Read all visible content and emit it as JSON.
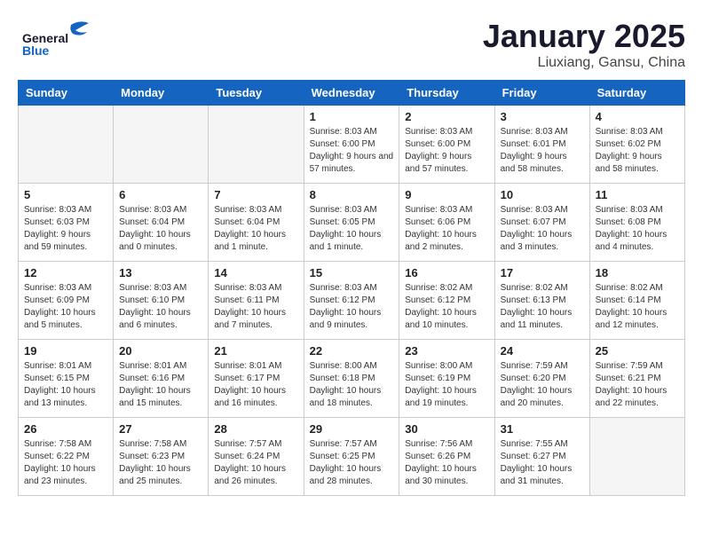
{
  "header": {
    "logo_general": "General",
    "logo_blue": "Blue",
    "month_title": "January 2025",
    "location": "Liuxiang, Gansu, China"
  },
  "columns": [
    "Sunday",
    "Monday",
    "Tuesday",
    "Wednesday",
    "Thursday",
    "Friday",
    "Saturday"
  ],
  "weeks": [
    [
      {
        "day": "",
        "info": ""
      },
      {
        "day": "",
        "info": ""
      },
      {
        "day": "",
        "info": ""
      },
      {
        "day": "1",
        "info": "Sunrise: 8:03 AM\nSunset: 6:00 PM\nDaylight: 9 hours\nand 57 minutes."
      },
      {
        "day": "2",
        "info": "Sunrise: 8:03 AM\nSunset: 6:00 PM\nDaylight: 9 hours\nand 57 minutes."
      },
      {
        "day": "3",
        "info": "Sunrise: 8:03 AM\nSunset: 6:01 PM\nDaylight: 9 hours\nand 58 minutes."
      },
      {
        "day": "4",
        "info": "Sunrise: 8:03 AM\nSunset: 6:02 PM\nDaylight: 9 hours\nand 58 minutes."
      }
    ],
    [
      {
        "day": "5",
        "info": "Sunrise: 8:03 AM\nSunset: 6:03 PM\nDaylight: 9 hours\nand 59 minutes."
      },
      {
        "day": "6",
        "info": "Sunrise: 8:03 AM\nSunset: 6:04 PM\nDaylight: 10 hours\nand 0 minutes."
      },
      {
        "day": "7",
        "info": "Sunrise: 8:03 AM\nSunset: 6:04 PM\nDaylight: 10 hours\nand 1 minute."
      },
      {
        "day": "8",
        "info": "Sunrise: 8:03 AM\nSunset: 6:05 PM\nDaylight: 10 hours\nand 1 minute."
      },
      {
        "day": "9",
        "info": "Sunrise: 8:03 AM\nSunset: 6:06 PM\nDaylight: 10 hours\nand 2 minutes."
      },
      {
        "day": "10",
        "info": "Sunrise: 8:03 AM\nSunset: 6:07 PM\nDaylight: 10 hours\nand 3 minutes."
      },
      {
        "day": "11",
        "info": "Sunrise: 8:03 AM\nSunset: 6:08 PM\nDaylight: 10 hours\nand 4 minutes."
      }
    ],
    [
      {
        "day": "12",
        "info": "Sunrise: 8:03 AM\nSunset: 6:09 PM\nDaylight: 10 hours\nand 5 minutes."
      },
      {
        "day": "13",
        "info": "Sunrise: 8:03 AM\nSunset: 6:10 PM\nDaylight: 10 hours\nand 6 minutes."
      },
      {
        "day": "14",
        "info": "Sunrise: 8:03 AM\nSunset: 6:11 PM\nDaylight: 10 hours\nand 7 minutes."
      },
      {
        "day": "15",
        "info": "Sunrise: 8:03 AM\nSunset: 6:12 PM\nDaylight: 10 hours\nand 9 minutes."
      },
      {
        "day": "16",
        "info": "Sunrise: 8:02 AM\nSunset: 6:12 PM\nDaylight: 10 hours\nand 10 minutes."
      },
      {
        "day": "17",
        "info": "Sunrise: 8:02 AM\nSunset: 6:13 PM\nDaylight: 10 hours\nand 11 minutes."
      },
      {
        "day": "18",
        "info": "Sunrise: 8:02 AM\nSunset: 6:14 PM\nDaylight: 10 hours\nand 12 minutes."
      }
    ],
    [
      {
        "day": "19",
        "info": "Sunrise: 8:01 AM\nSunset: 6:15 PM\nDaylight: 10 hours\nand 13 minutes."
      },
      {
        "day": "20",
        "info": "Sunrise: 8:01 AM\nSunset: 6:16 PM\nDaylight: 10 hours\nand 15 minutes."
      },
      {
        "day": "21",
        "info": "Sunrise: 8:01 AM\nSunset: 6:17 PM\nDaylight: 10 hours\nand 16 minutes."
      },
      {
        "day": "22",
        "info": "Sunrise: 8:00 AM\nSunset: 6:18 PM\nDaylight: 10 hours\nand 18 minutes."
      },
      {
        "day": "23",
        "info": "Sunrise: 8:00 AM\nSunset: 6:19 PM\nDaylight: 10 hours\nand 19 minutes."
      },
      {
        "day": "24",
        "info": "Sunrise: 7:59 AM\nSunset: 6:20 PM\nDaylight: 10 hours\nand 20 minutes."
      },
      {
        "day": "25",
        "info": "Sunrise: 7:59 AM\nSunset: 6:21 PM\nDaylight: 10 hours\nand 22 minutes."
      }
    ],
    [
      {
        "day": "26",
        "info": "Sunrise: 7:58 AM\nSunset: 6:22 PM\nDaylight: 10 hours\nand 23 minutes."
      },
      {
        "day": "27",
        "info": "Sunrise: 7:58 AM\nSunset: 6:23 PM\nDaylight: 10 hours\nand 25 minutes."
      },
      {
        "day": "28",
        "info": "Sunrise: 7:57 AM\nSunset: 6:24 PM\nDaylight: 10 hours\nand 26 minutes."
      },
      {
        "day": "29",
        "info": "Sunrise: 7:57 AM\nSunset: 6:25 PM\nDaylight: 10 hours\nand 28 minutes."
      },
      {
        "day": "30",
        "info": "Sunrise: 7:56 AM\nSunset: 6:26 PM\nDaylight: 10 hours\nand 30 minutes."
      },
      {
        "day": "31",
        "info": "Sunrise: 7:55 AM\nSunset: 6:27 PM\nDaylight: 10 hours\nand 31 minutes."
      },
      {
        "day": "",
        "info": ""
      }
    ]
  ]
}
